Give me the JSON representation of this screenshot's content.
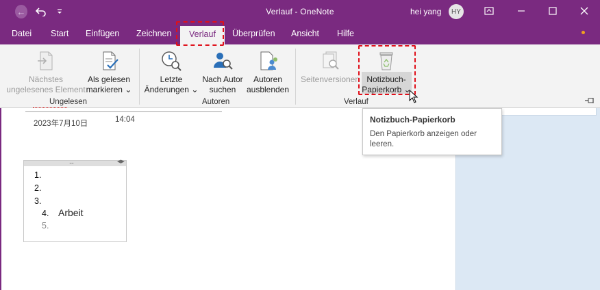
{
  "titlebar": {
    "title": "Verlauf  -  OneNote",
    "user_name": "hei yang",
    "avatar_initials": "HY",
    "accent_color": "#7a2a80"
  },
  "menu": {
    "tabs": [
      "Datei",
      "Start",
      "Einfügen",
      "Zeichnen",
      "Verlauf",
      "Überprüfen",
      "Ansicht",
      "Hilfe"
    ],
    "active_tab": "Verlauf"
  },
  "ribbon": {
    "groups": {
      "ungelesen": {
        "label": "Ungelesen",
        "next_unread": [
          "Nächstes",
          "ungelesenes Element"
        ],
        "mark_read": [
          "Als gelesen",
          "markieren"
        ]
      },
      "autoren": {
        "label": "Autoren",
        "recent_changes": [
          "Letzte",
          "Änderungen"
        ],
        "by_author": [
          "Nach Autor",
          "suchen"
        ],
        "hide_authors": [
          "Autoren",
          "ausblenden"
        ]
      },
      "verlauf": {
        "label": "Verlauf",
        "page_versions": "Seitenversionen",
        "notebook_recycle_bin": [
          "Notizbuch-",
          "Papierkorb"
        ]
      }
    },
    "dropdown_glyph": "⌄"
  },
  "page": {
    "date": "2023年7月10日",
    "time": "14:04",
    "list": [
      {
        "num": "1.",
        "text": ""
      },
      {
        "num": "2.",
        "text": ""
      },
      {
        "num": "3.",
        "text": ""
      },
      {
        "num": "4.",
        "text": "Arbeit"
      },
      {
        "num": "5.",
        "text": ""
      }
    ]
  },
  "tooltip": {
    "title": "Notizbuch-Papierkorb",
    "description_lines": [
      "Den Papierkorb anzeigen oder",
      "leeren."
    ]
  },
  "icons": {
    "back": "back-arrow-icon",
    "undo": "undo-icon",
    "customize": "customize-quick-access-icon",
    "restore": "ribbon-display-options-icon",
    "minimize": "minimize-icon",
    "maximize": "maximize-icon",
    "close": "close-icon",
    "pin": "pin-ribbon-icon"
  }
}
